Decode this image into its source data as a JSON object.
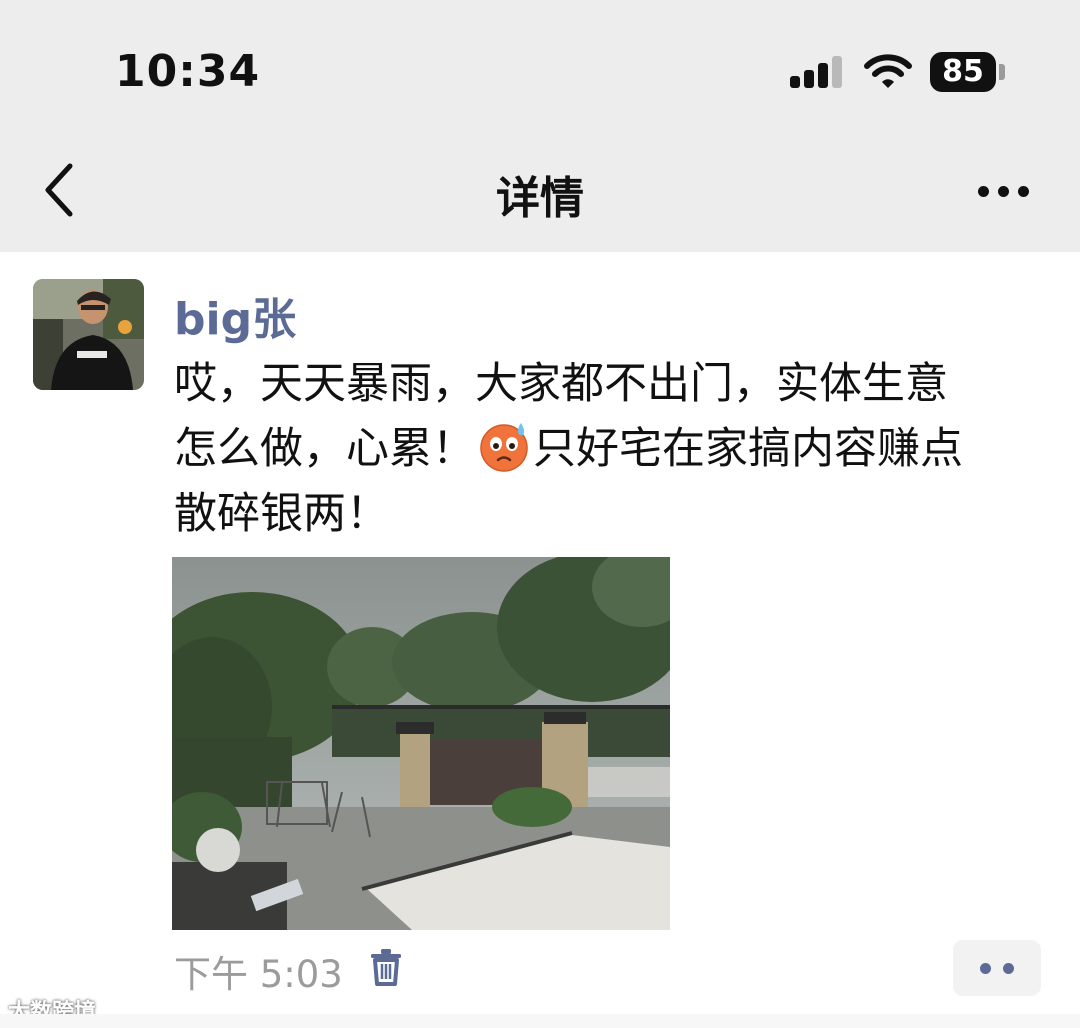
{
  "status_bar": {
    "time": "10:34",
    "battery": "85",
    "icons": [
      "signal-icon",
      "wifi-icon",
      "battery-icon"
    ]
  },
  "nav": {
    "title": "详情",
    "back_icon": "chevron-left-icon",
    "more_icon": "more-icon"
  },
  "post": {
    "author": "big张",
    "avatar": "user-avatar",
    "content": {
      "line1": "哎，天天暴雨，大家都不出门，实体生意",
      "line2_before": "怎么做，心累！",
      "line2_emoji": "sweating-face-emoji",
      "line2_after": "只好宅在家搞内容赚点",
      "line3": "散碎银两！"
    },
    "photo": "rainy-courtyard-photo",
    "time": "下午 5:03",
    "delete_icon": "trash-icon",
    "action_icon": "more-dots-icon"
  },
  "watermark": "大数跨境",
  "colors": {
    "header_bg": "#ededed",
    "author_blue": "#5b6b95",
    "time_gray": "#9b9b9b"
  }
}
